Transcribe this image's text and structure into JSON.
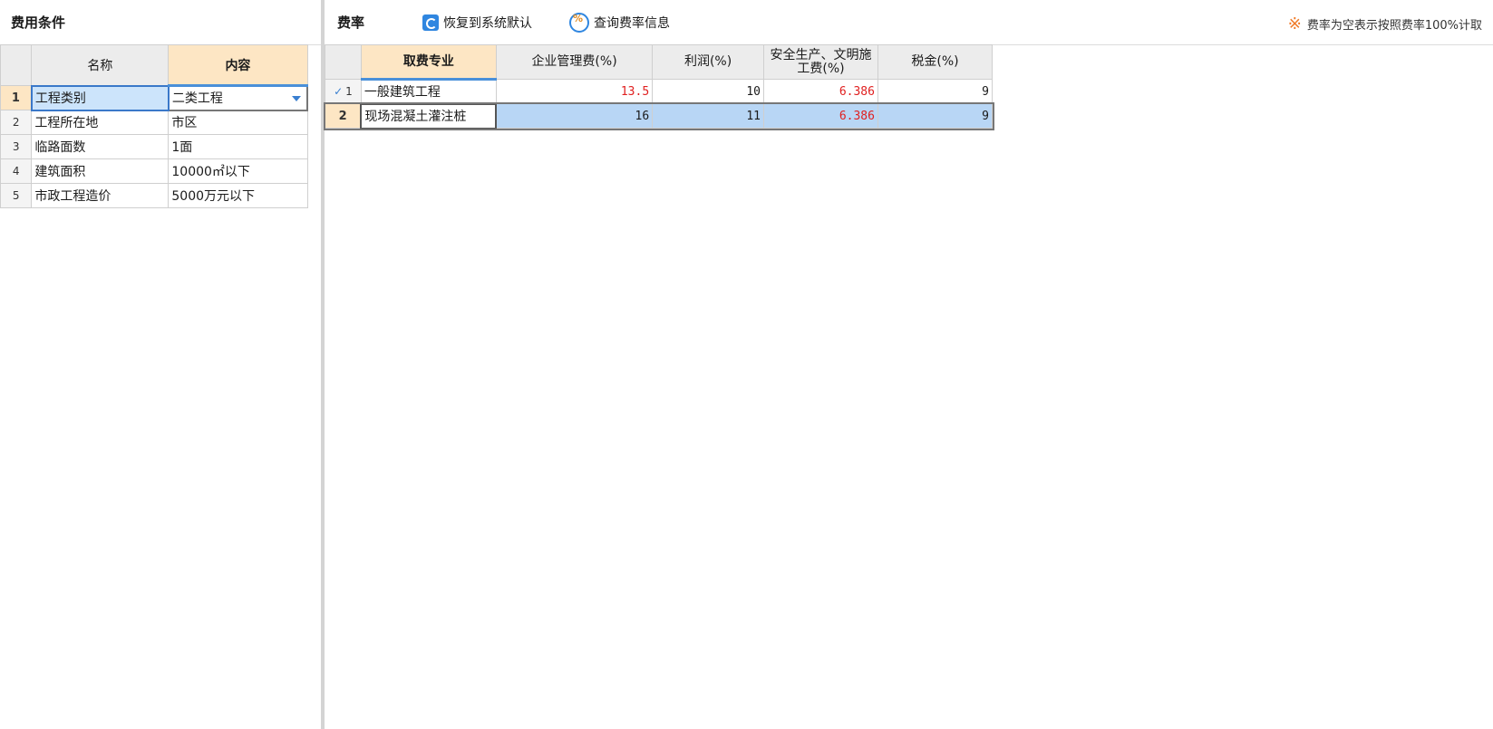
{
  "left": {
    "title": "费用条件",
    "columns": {
      "name": "名称",
      "content": "内容"
    },
    "rows": [
      {
        "num": "1",
        "name": "工程类别",
        "value": "二类工程"
      },
      {
        "num": "2",
        "name": "工程所在地",
        "value": "市区"
      },
      {
        "num": "3",
        "name": "临路面数",
        "value": "1面"
      },
      {
        "num": "4",
        "name": "建筑面积",
        "value": "10000㎡以下"
      },
      {
        "num": "5",
        "name": "市政工程造价",
        "value": "5000万元以下"
      }
    ]
  },
  "right": {
    "title": "费率",
    "toolbar": {
      "restore_label": "恢复到系统默认",
      "query_label": "查询费率信息"
    },
    "notice": "费率为空表示按照费率100%计取",
    "notice_mark": "※",
    "columns": {
      "specialty": "取费专业",
      "mgmt": "企业管理费(%)",
      "profit": "利润(%)",
      "safety_line1": "安全生产、文明施",
      "safety_line2": "工费(%)",
      "tax": "税金(%)"
    },
    "rows": [
      {
        "num": "1",
        "specialty": "一般建筑工程",
        "mgmt": "13.5",
        "profit": "10",
        "safety": "6.386",
        "tax": "9"
      },
      {
        "num": "2",
        "specialty": "现场混凝土灌注桩",
        "mgmt": "16",
        "profit": "11",
        "safety": "6.386",
        "tax": "9"
      }
    ]
  },
  "colors": {
    "accent": "#3a7fd0",
    "highlight": "#fde6c4",
    "red": "#e02020",
    "notice": "#f07a28"
  }
}
